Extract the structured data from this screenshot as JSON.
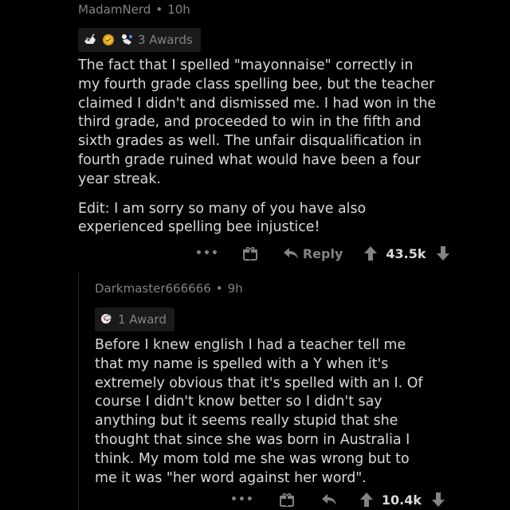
{
  "comments": [
    {
      "author": "MadamNerd",
      "separator": "•",
      "age": "10h",
      "awards_label": "3 Awards",
      "awards": [
        "gold-hand-award-icon",
        "gold-laurel-award-icon",
        "bowing-figure-award-icon"
      ],
      "paragraphs": [
        "The fact that I spelled \"mayonnaise\" correctly in my fourth grade class spelling bee, but the teacher claimed I didn't and dismissed me. I had won in the third grade, and proceeded to win in the fifth and sixth grades as well. The unfair disqualification in fourth grade ruined what would have been a four year streak.",
        "Edit: I am sorry so many of you have also experienced spelling bee injustice!"
      ],
      "more_label": "•••",
      "reply_label": "Reply",
      "score": "43.5k"
    },
    {
      "author": "Darkmaster666666",
      "separator": "•",
      "age": "9h",
      "awards_label": "1 Award",
      "awards": [
        "facepalm-award-icon"
      ],
      "paragraphs": [
        "Before I knew english I had a teacher tell me that my name is spelled with a Y when it's extremely obvious that it's spelled with an I. Of course I didn't know better so I didn't say anything but it seems really stupid that she thought that since she was born in Australia I think. My mom told me she was wrong but to me it was \"her word against her word\"."
      ],
      "more_label": "•••",
      "score": "10.4k"
    }
  ],
  "colors": {
    "background": "#000000",
    "text": "#d7dadc",
    "meta": "#818384",
    "chip": "#1a1a1b"
  }
}
